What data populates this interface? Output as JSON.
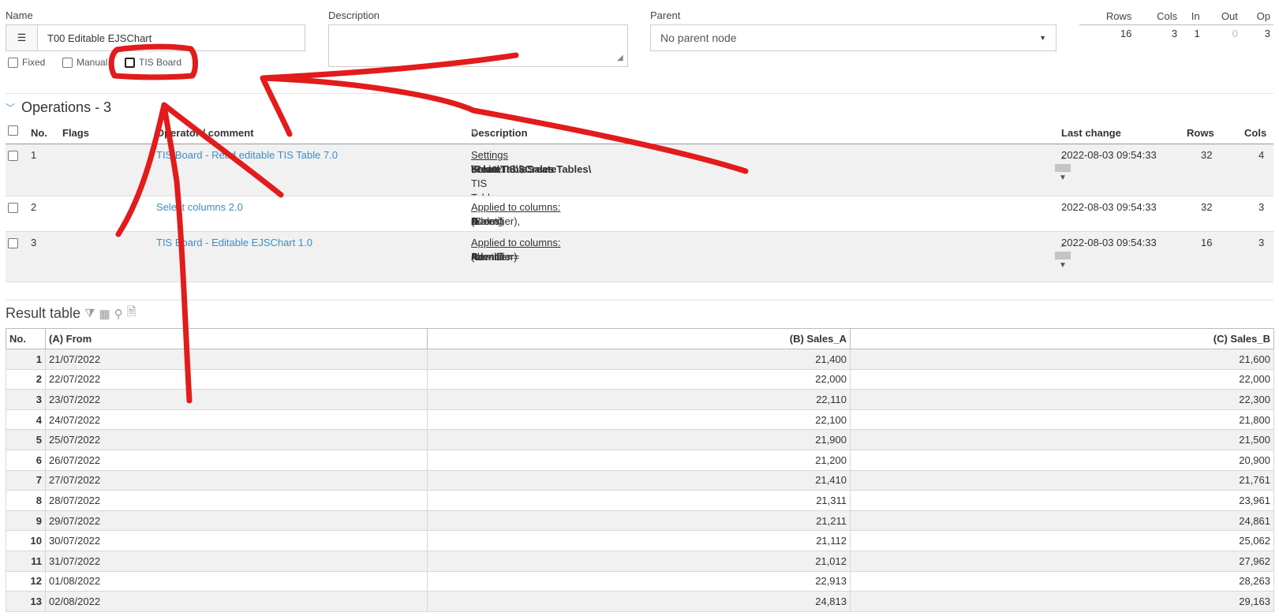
{
  "form": {
    "name_label": "Name",
    "name_icon_glyph": "☰",
    "name_value": "T00 Editable EJSChart",
    "description_label": "Description",
    "description_value": "",
    "parent_label": "Parent",
    "parent_value": "No parent node",
    "checkbox_fixed": "Fixed",
    "checkbox_manual": "Manual",
    "checkbox_tis_board": "TIS Board"
  },
  "stats": {
    "headers": [
      "Rows",
      "Cols",
      "In",
      "Out",
      "Op"
    ],
    "values": [
      "16",
      "3",
      "1",
      "0",
      "3"
    ]
  },
  "operations": {
    "title": "Operations - 3",
    "columns": {
      "no": "No.",
      "flags": "Flags",
      "operator": "Operator / comment",
      "description": "Description",
      "last_change": "Last change",
      "rows": "Rows",
      "cols": "Cols"
    },
    "rows": [
      {
        "no": "1",
        "operator": "TIS Board - Read editable TIS Table 7.0",
        "desc_heading": "Settings",
        "desc_line1_prefix": "Folder: ",
        "desc_line1_bold": "\\Root\\TIS\\$CreateTables\\",
        "desc_line2_prefix": "Select TIS Table: ",
        "desc_line2_bold": "createTableSales",
        "last_change": "2022-08-03 09:54:33",
        "rows": "32",
        "cols": "4"
      },
      {
        "no": "2",
        "operator": "Select columns 2.0",
        "desc_heading": "Applied to columns:",
        "desc_a": "A",
        "desc_a_name": " (Identifier), ",
        "desc_b": "B",
        "desc_b_name": " (From), ",
        "desc_d": "D",
        "desc_d_name": " (Sales)",
        "last_change": "2022-08-03 09:54:33",
        "rows": "32",
        "cols": "3"
      },
      {
        "no": "3",
        "operator": "TIS Board - Editable EJSChart 1.0",
        "desc_heading": "Applied to columns:",
        "desc_line1_prefix": "Row ID = ",
        "desc_line1_bold": "A",
        "desc_line1_suffix": " (Identifier)",
        "desc_line2_prefix": "Identifier = ",
        "desc_line2_bold": "A",
        "desc_line2_suffix": " (Identifier)",
        "last_change": "2022-08-03 09:54:33",
        "rows": "16",
        "cols": "3"
      }
    ]
  },
  "result": {
    "title": "Result table",
    "icons": [
      "filter-icon",
      "table-icon",
      "zoom-icon",
      "excel-icon"
    ],
    "headers": [
      "No.",
      "(A) From",
      "(B) Sales_A",
      "(C) Sales_B"
    ],
    "rows": [
      [
        "1",
        "21/07/2022",
        "21,400",
        "21,600"
      ],
      [
        "2",
        "22/07/2022",
        "22,000",
        "22,000"
      ],
      [
        "3",
        "23/07/2022",
        "22,110",
        "22,300"
      ],
      [
        "4",
        "24/07/2022",
        "22,100",
        "21,800"
      ],
      [
        "5",
        "25/07/2022",
        "21,900",
        "21,500"
      ],
      [
        "6",
        "26/07/2022",
        "21,200",
        "20,900"
      ],
      [
        "7",
        "27/07/2022",
        "21,410",
        "21,761"
      ],
      [
        "8",
        "28/07/2022",
        "21,311",
        "23,961"
      ],
      [
        "9",
        "29/07/2022",
        "21,211",
        "24,861"
      ],
      [
        "10",
        "30/07/2022",
        "21,112",
        "25,062"
      ],
      [
        "11",
        "31/07/2022",
        "21,012",
        "27,962"
      ],
      [
        "12",
        "01/08/2022",
        "22,913",
        "28,263"
      ],
      [
        "13",
        "02/08/2022",
        "24,813",
        "29,163"
      ]
    ]
  },
  "colors": {
    "link": "#3a8ec9",
    "annotation": "#e21b1b"
  }
}
